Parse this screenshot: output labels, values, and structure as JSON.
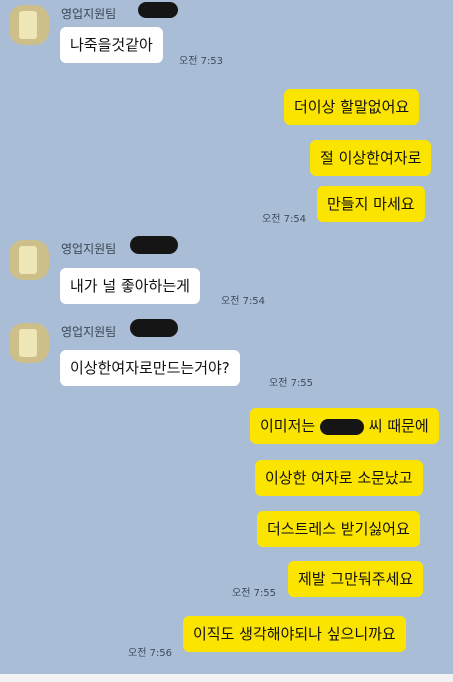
{
  "sender": "영업지원팀",
  "messages": [
    {
      "text": "나죽을것같아",
      "time": "오전 7:53"
    },
    {
      "text": "더이상 할말없어요"
    },
    {
      "text": "절 이상한여자로"
    },
    {
      "text": "만들지 마세요",
      "time": "오전 7:54"
    },
    {
      "text": "내가 널 좋아하는게",
      "time": "오전 7:54"
    },
    {
      "text": "이상한여자로만드는거야?",
      "time": "오전 7:55"
    },
    {
      "text": "이미저는",
      "text2": "씨 때문에"
    },
    {
      "text": "이상한 여자로 소문났고"
    },
    {
      "text": "더스트레스 받기싫어요"
    },
    {
      "text": "제발 그만둬주세요",
      "time": "오전 7:55"
    },
    {
      "text": "이직도 생각해야되나 싶으니까요",
      "time": "오전 7:56"
    }
  ]
}
